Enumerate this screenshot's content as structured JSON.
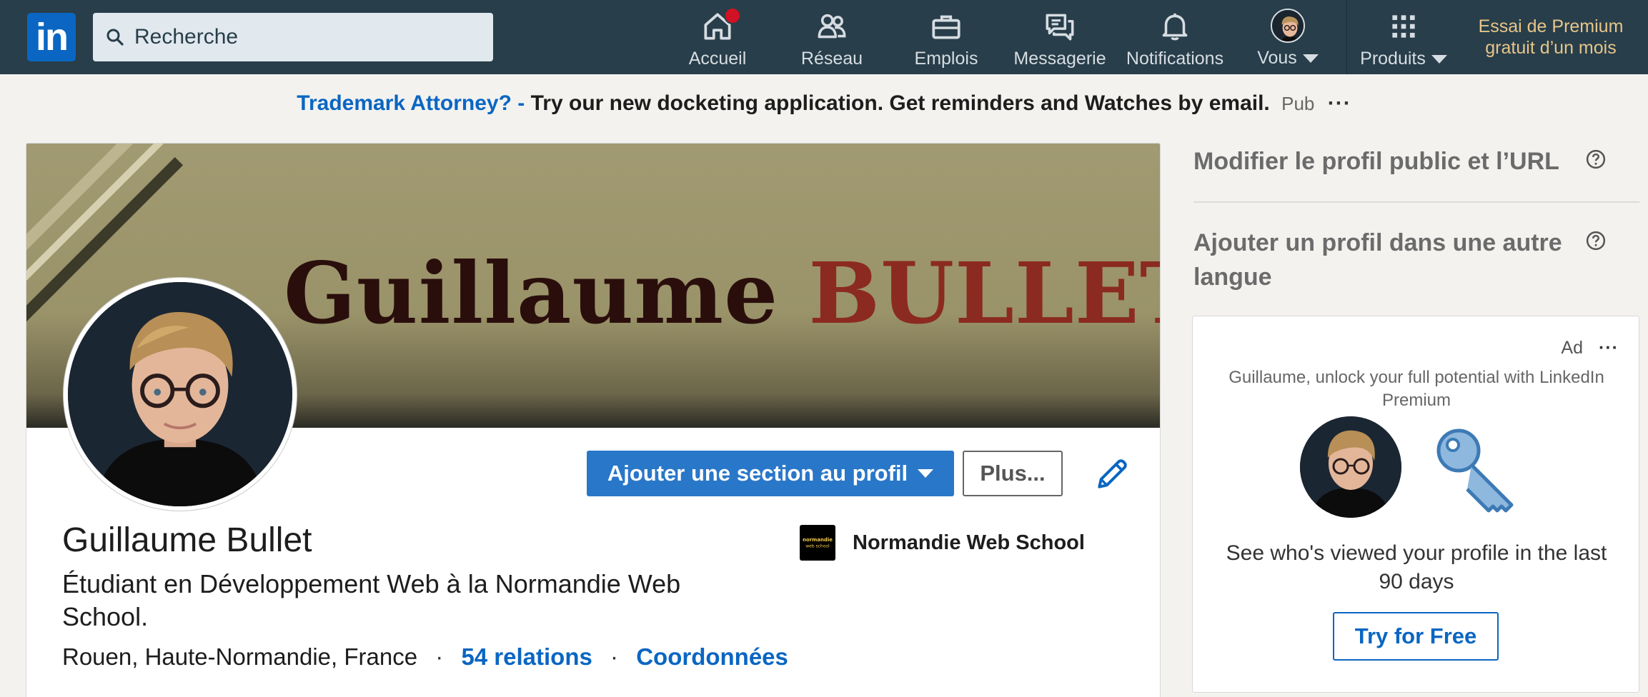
{
  "nav": {
    "logo_text": "in",
    "search_placeholder": "Recherche",
    "items": [
      {
        "label": "Accueil",
        "icon": "home-icon",
        "has_badge": true
      },
      {
        "label": "Réseau",
        "icon": "network-icon"
      },
      {
        "label": "Emplois",
        "icon": "briefcase-icon"
      },
      {
        "label": "Messagerie",
        "icon": "messaging-icon"
      },
      {
        "label": "Notifications",
        "icon": "bell-icon"
      },
      {
        "label": "Vous",
        "icon": "user-avatar"
      },
      {
        "label": "Produits",
        "icon": "grid-icon"
      }
    ],
    "premium_line1": "Essai de Premium",
    "premium_line2": "gratuit d’un mois",
    "colors": {
      "bar": "#283e4a",
      "premium": "#e7c58a",
      "badge": "#d11124"
    }
  },
  "ad_banner": {
    "link_text": "Trademark Attorney? -",
    "text": "Try our new docketing application. Get reminders and Watches by email.",
    "pub_label": "Pub",
    "menu": "···"
  },
  "profile": {
    "banner_first": "Guillaume",
    "banner_last": "BULLET",
    "name": "Guillaume Bullet",
    "headline": "Étudiant en Développement Web à la Normandie Web School.",
    "location": "Rouen, Haute-Normandie, France",
    "separator": "·",
    "relations": "54 relations",
    "contact": "Coordonnées",
    "school": "Normandie Web School",
    "school_logo_text": "normandie web school",
    "add_section_label": "Ajouter une section au profil",
    "more_label": "Plus...",
    "accent": "#2977c9"
  },
  "right_rail": {
    "edit_public": "Modifier le profil public et l’URL",
    "add_language": "Ajouter un profil dans une autre langue",
    "ad": {
      "label": "Ad",
      "menu": "···",
      "copy": "Guillaume, unlock your full potential with LinkedIn Premium",
      "headline": "See who's viewed your profile in the last 90 days",
      "cta": "Try for Free"
    }
  }
}
